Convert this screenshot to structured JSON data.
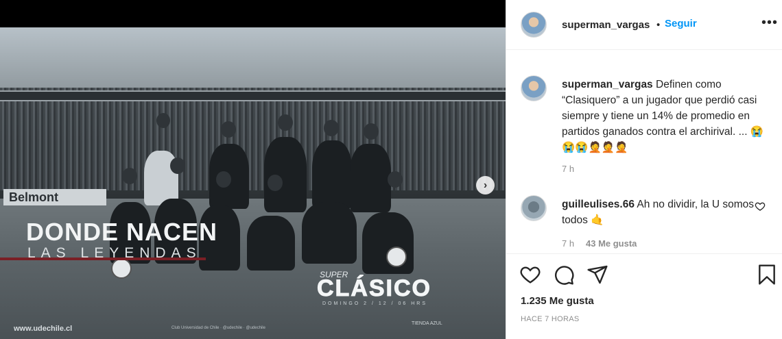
{
  "media": {
    "board_text": "Belmont",
    "headline": "DONDE NACEN",
    "subline": "LAS LEYENDAS",
    "super": "SUPER",
    "clasico": "CLÁSICO",
    "domingo": "DOMINGO 2 / 12 / 06 HRS",
    "website": "www.udechile.cl",
    "footer_small": "Club Universidad de Chile · @udechile · @udechile",
    "tienda": "TIENDA AZUL",
    "next_icon": "chevron-right-icon"
  },
  "post": {
    "username": "superman_vargas",
    "dot": "•",
    "follow_label": "Seguir",
    "more_label": "•••",
    "caption_user": "superman_vargas",
    "caption_text": "Definen como “Clasiquero” a un jugador que perdió casi siempre y tiene un 14% de promedio en partidos ganados contra el archirival. ... 😭😭😭🤦🤦🤦",
    "caption_time": "7 h",
    "comment_user": "guilleulises.66",
    "comment_text": "Ah no dividir, la U somos todos 🤙",
    "comment_time": "7 h",
    "comment_likes": "43 Me gusta",
    "like_count": "1.235 Me gusta",
    "posted_ago": "HACE 7 HORAS"
  },
  "icons": {
    "like": "heart-icon",
    "comment": "comment-icon",
    "share": "share-icon",
    "save": "bookmark-icon",
    "comment_like": "heart-icon"
  },
  "colors": {
    "accent": "#0095f6",
    "text": "#262626",
    "muted": "#8e8e8e"
  }
}
